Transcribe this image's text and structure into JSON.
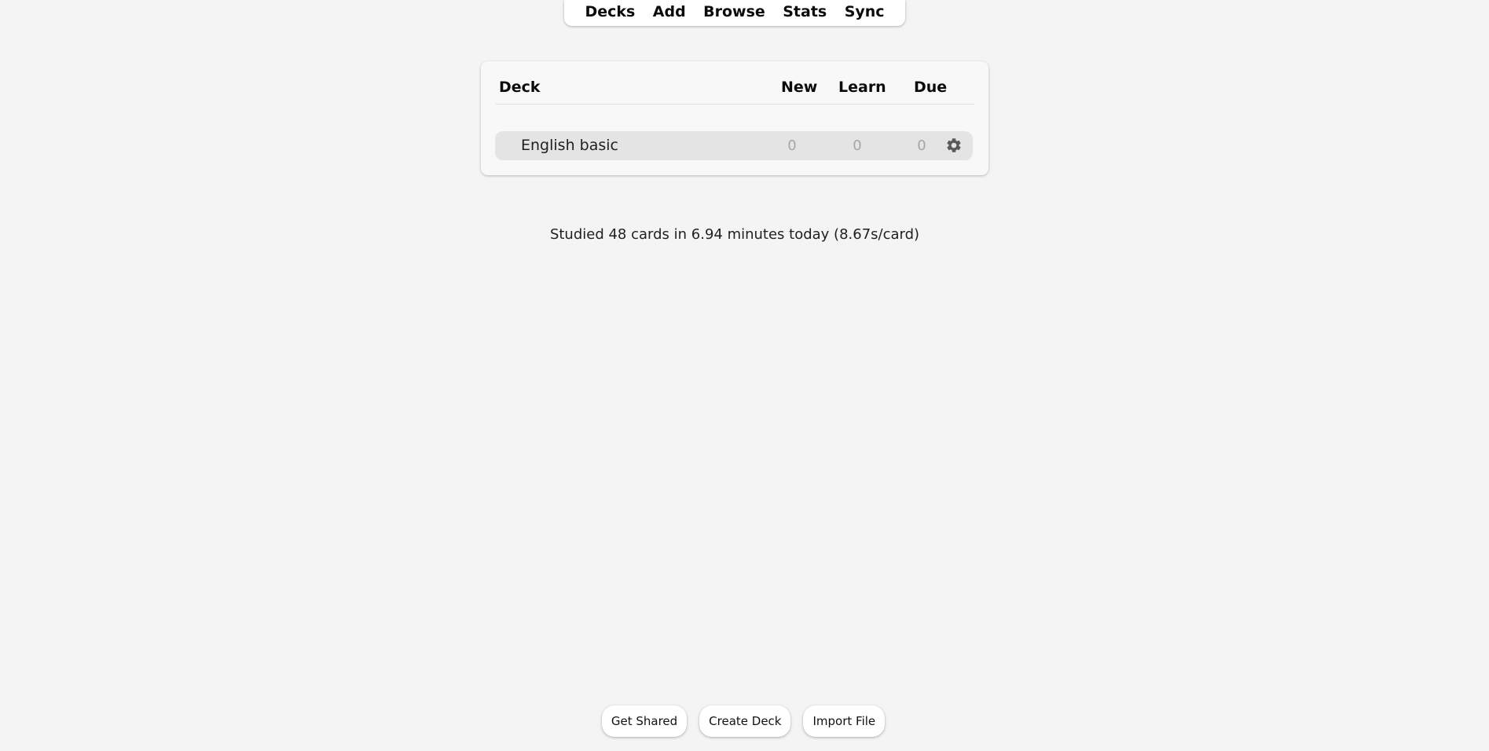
{
  "toolbar": {
    "items": [
      "Decks",
      "Add",
      "Browse",
      "Stats",
      "Sync"
    ]
  },
  "deck_table": {
    "headers": {
      "deck": "Deck",
      "new": "New",
      "learn": "Learn",
      "due": "Due"
    },
    "rows": [
      {
        "name": "English basic",
        "new": "0",
        "learn": "0",
        "due": "0",
        "options_icon": "gear-icon"
      }
    ]
  },
  "studied_text": "Studied 48 cards in 6.94 minutes today (8.67s/card)",
  "bottom_buttons": {
    "get_shared": "Get Shared",
    "create_deck": "Create Deck",
    "import_file": "Import File"
  },
  "colors": {
    "background": "#f4f4f4",
    "panel": "#f8f8f8",
    "row_highlight": "#e4e4e4",
    "zero_count": "#a6a6a6"
  }
}
